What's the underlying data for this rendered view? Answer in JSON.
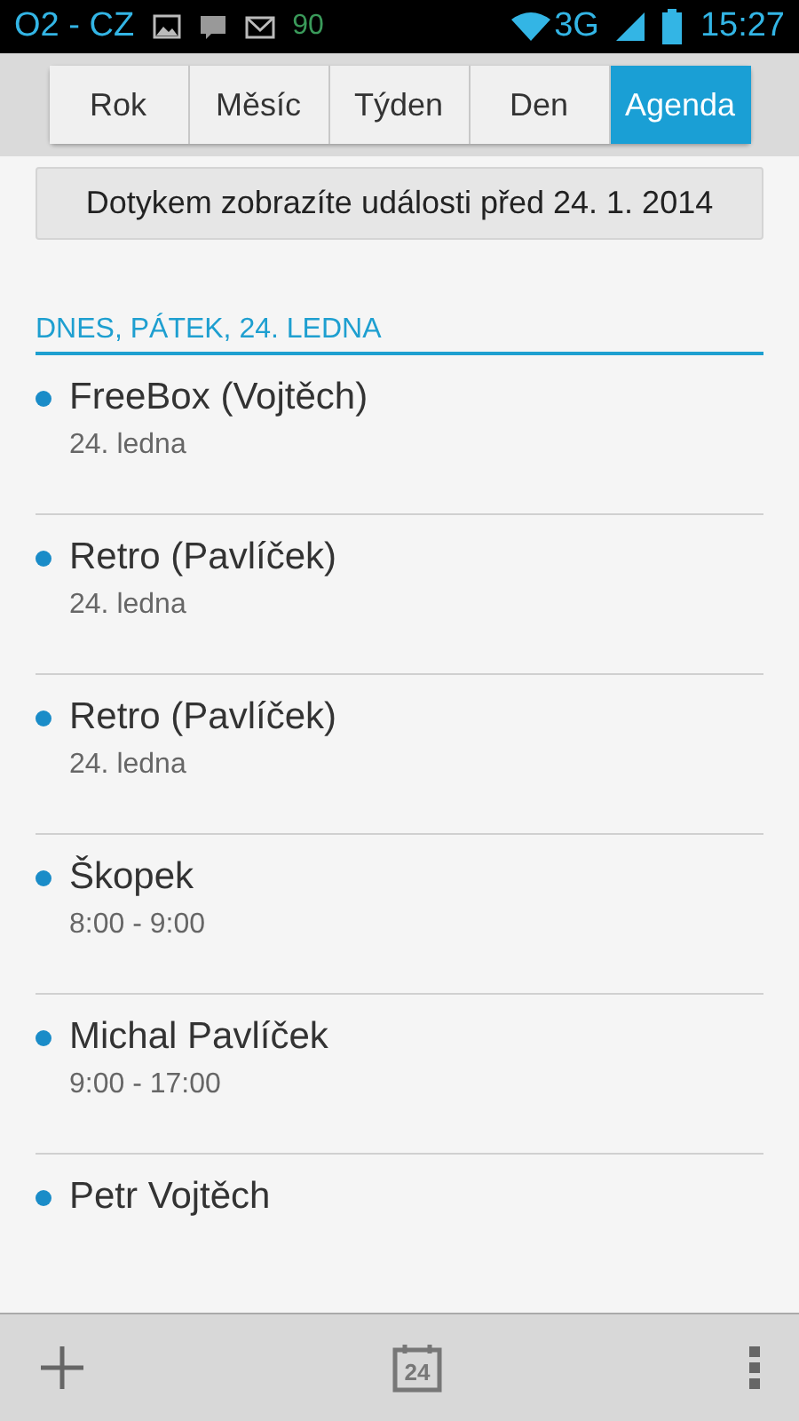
{
  "status_bar": {
    "carrier": "O2 - CZ",
    "badge": "90",
    "network": "3G",
    "time": "15:27"
  },
  "tabs": [
    {
      "label": "Rok",
      "selected": false
    },
    {
      "label": "Měsíc",
      "selected": false
    },
    {
      "label": "Týden",
      "selected": false
    },
    {
      "label": "Den",
      "selected": false
    },
    {
      "label": "Agenda",
      "selected": true
    }
  ],
  "load_earlier_button": "Dotykem zobrazíte události před 24. 1. 2014",
  "day_header": "DNES, PÁTEK, 24. LEDNA",
  "events": [
    {
      "title": "FreeBox (Vojtěch)",
      "when": "24. ledna"
    },
    {
      "title": "Retro (Pavlíček)",
      "when": "24. ledna"
    },
    {
      "title": "Retro (Pavlíček)",
      "when": "24. ledna"
    },
    {
      "title": "Škopek",
      "when": "8:00 - 9:00"
    },
    {
      "title": "Michal Pavlíček",
      "when": "9:00 - 17:00"
    },
    {
      "title": "Petr Vojtěch"
    }
  ],
  "bottom_bar": {
    "today_day": "24"
  }
}
